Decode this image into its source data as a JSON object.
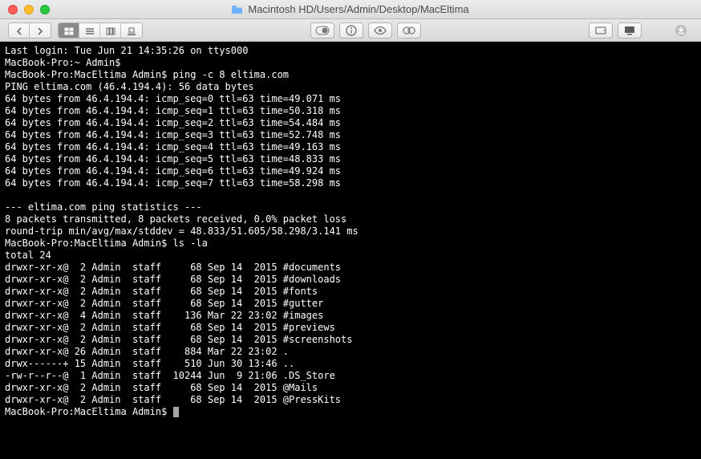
{
  "window": {
    "title": "Macintosh HD/Users/Admin/Desktop/MacEltima"
  },
  "terminal": {
    "last_login": "Last login: Tue Jun 21 14:35:26 on ttys000",
    "prompt_home": "MacBook-Pro:~ Admin$",
    "prompt_maceltima": "MacBook-Pro:MacEltima Admin$",
    "cmd_ping": "ping -c 8 eltima.com",
    "ping_header": "PING eltima.com (46.4.194.4): 56 data bytes",
    "ping_replies": [
      "64 bytes from 46.4.194.4: icmp_seq=0 ttl=63 time=49.071 ms",
      "64 bytes from 46.4.194.4: icmp_seq=1 ttl=63 time=50.318 ms",
      "64 bytes from 46.4.194.4: icmp_seq=2 ttl=63 time=54.484 ms",
      "64 bytes from 46.4.194.4: icmp_seq=3 ttl=63 time=52.748 ms",
      "64 bytes from 46.4.194.4: icmp_seq=4 ttl=63 time=49.163 ms",
      "64 bytes from 46.4.194.4: icmp_seq=5 ttl=63 time=48.833 ms",
      "64 bytes from 46.4.194.4: icmp_seq=6 ttl=63 time=49.924 ms",
      "64 bytes from 46.4.194.4: icmp_seq=7 ttl=63 time=58.298 ms"
    ],
    "ping_stats_header": "--- eltima.com ping statistics ---",
    "ping_stats_summary": "8 packets transmitted, 8 packets received, 0.0% packet loss",
    "ping_stats_rt": "round-trip min/avg/max/stddev = 48.833/51.605/58.298/3.141 ms",
    "cmd_ls": "ls -la",
    "ls_total": "total 24",
    "ls_rows": [
      "drwxr-xr-x@  2 Admin  staff     68 Sep 14  2015 #documents",
      "drwxr-xr-x@  2 Admin  staff     68 Sep 14  2015 #downloads",
      "drwxr-xr-x@  2 Admin  staff     68 Sep 14  2015 #fonts",
      "drwxr-xr-x@  2 Admin  staff     68 Sep 14  2015 #gutter",
      "drwxr-xr-x@  4 Admin  staff    136 Mar 22 23:02 #images",
      "drwxr-xr-x@  2 Admin  staff     68 Sep 14  2015 #previews",
      "drwxr-xr-x@  2 Admin  staff     68 Sep 14  2015 #screenshots",
      "drwxr-xr-x@ 26 Admin  staff    884 Mar 22 23:02 .",
      "drwx------+ 15 Admin  staff    510 Jun 30 13:46 ..",
      "-rw-r--r--@  1 Admin  staff  10244 Jun  9 21:06 .DS_Store",
      "drwxr-xr-x@  2 Admin  staff     68 Sep 14  2015 @Mails",
      "drwxr-xr-x@  2 Admin  staff     68 Sep 14  2015 @PressKits"
    ]
  }
}
